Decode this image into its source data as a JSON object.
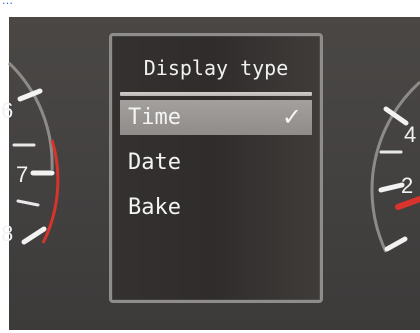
{
  "top_caption": "…",
  "left_gauge": {
    "labels": [
      "6",
      "7",
      "8"
    ]
  },
  "right_gauge": {
    "labels": [
      "4",
      "2"
    ]
  },
  "menu": {
    "title": "Display type",
    "items": [
      {
        "label": "Time",
        "selected": true
      },
      {
        "label": "Date",
        "selected": false
      },
      {
        "label": "Bake",
        "selected": false
      }
    ]
  },
  "icons": {
    "selected": "check-icon"
  },
  "colors": {
    "background": "#434140",
    "accent_red": "#d8342d",
    "menu_border": "#8f8d8b",
    "text": "#f2f2f2"
  }
}
